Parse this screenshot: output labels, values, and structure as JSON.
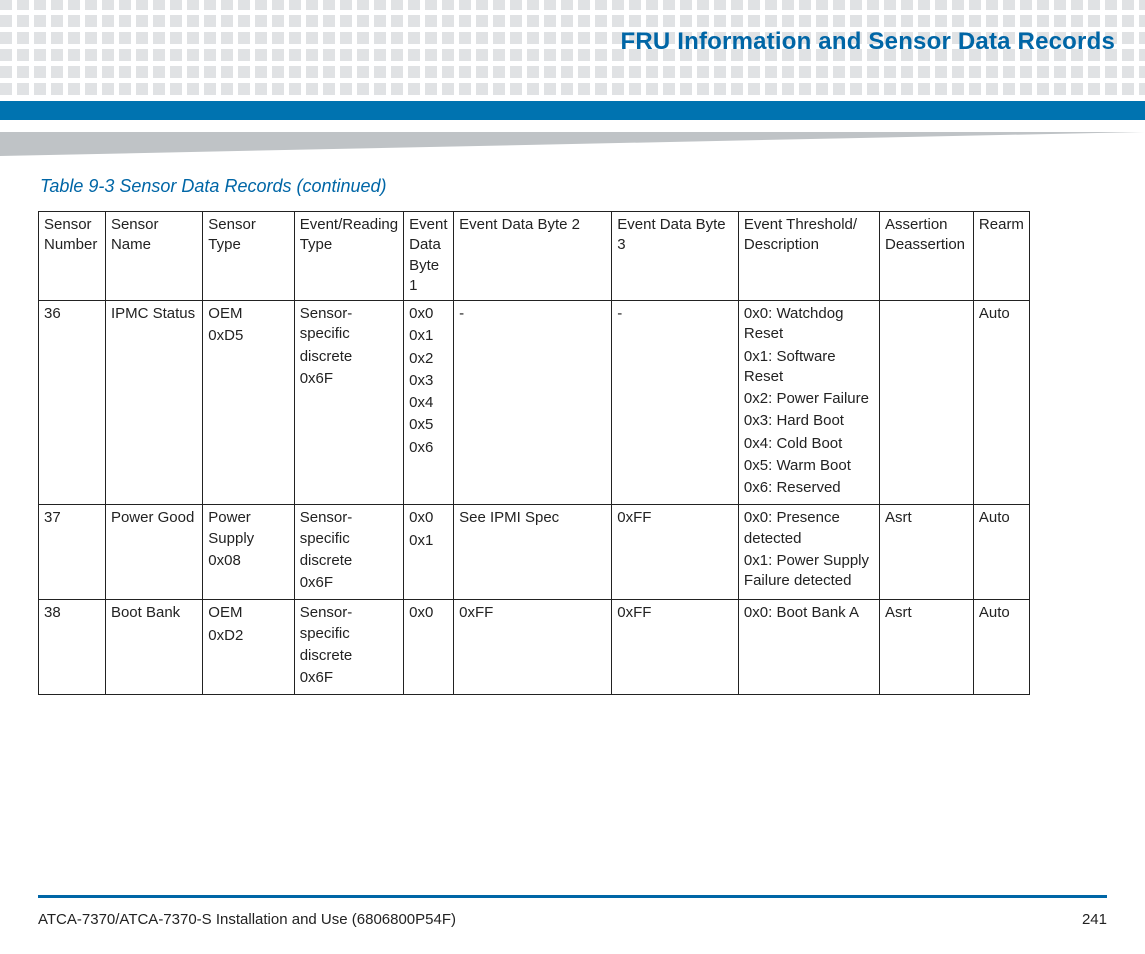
{
  "page_title": "FRU Information and Sensor Data Records",
  "table_caption": "Table 9-3 Sensor Data Records  (continued)",
  "columns": {
    "c0": "Sensor Number",
    "c1": "Sensor Name",
    "c2": "Sensor Type",
    "c3": "Event/Reading Type",
    "c4": "Event Data Byte 1",
    "c5": "Event Data Byte 2",
    "c6": "Event Data Byte 3",
    "c7": "Event Threshold/ Description",
    "c8": "Assertion Deassertion",
    "c9": "Rearm"
  },
  "rows": [
    {
      "num": "36",
      "name": "IPMC Status",
      "type_l1": "OEM",
      "type_l2": "0xD5",
      "ert_l1": "Sensor-specific",
      "ert_l2": "discrete",
      "ert_l3": "0x6F",
      "b1": [
        "0x0",
        "0x1",
        "0x2",
        "0x3",
        "0x4",
        "0x5",
        "0x6"
      ],
      "b2": "-",
      "b3": "-",
      "desc": [
        "0x0: Watchdog Reset",
        "0x1: Software Reset",
        "0x2: Power Failure",
        "0x3: Hard Boot",
        "0x4: Cold Boot",
        "0x5: Warm Boot",
        "0x6: Reserved"
      ],
      "ad": "",
      "rearm": "Auto"
    },
    {
      "num": "37",
      "name": "Power Good",
      "type_l1": "Power Supply",
      "type_l2": "0x08",
      "ert_l1": "Sensor-specific",
      "ert_l2": "discrete",
      "ert_l3": "0x6F",
      "b1": [
        "0x0",
        "0x1"
      ],
      "b2": "See IPMI Spec",
      "b3": "0xFF",
      "desc": [
        "0x0: Presence detected",
        "0x1: Power Supply Failure detected"
      ],
      "ad": "Asrt",
      "rearm": "Auto"
    },
    {
      "num": "38",
      "name": "Boot Bank",
      "type_l1": "OEM",
      "type_l2": "0xD2",
      "ert_l1": "Sensor-specific",
      "ert_l2": "discrete",
      "ert_l3": "0x6F",
      "b1": [
        "0x0"
      ],
      "b2": "0xFF",
      "b3": "0xFF",
      "desc": [
        "0x0: Boot Bank A"
      ],
      "ad": "Asrt",
      "rearm": "Auto"
    }
  ],
  "footer_left": "ATCA-7370/ATCA-7370-S Installation and Use (6806800P54F)",
  "footer_right": "241"
}
